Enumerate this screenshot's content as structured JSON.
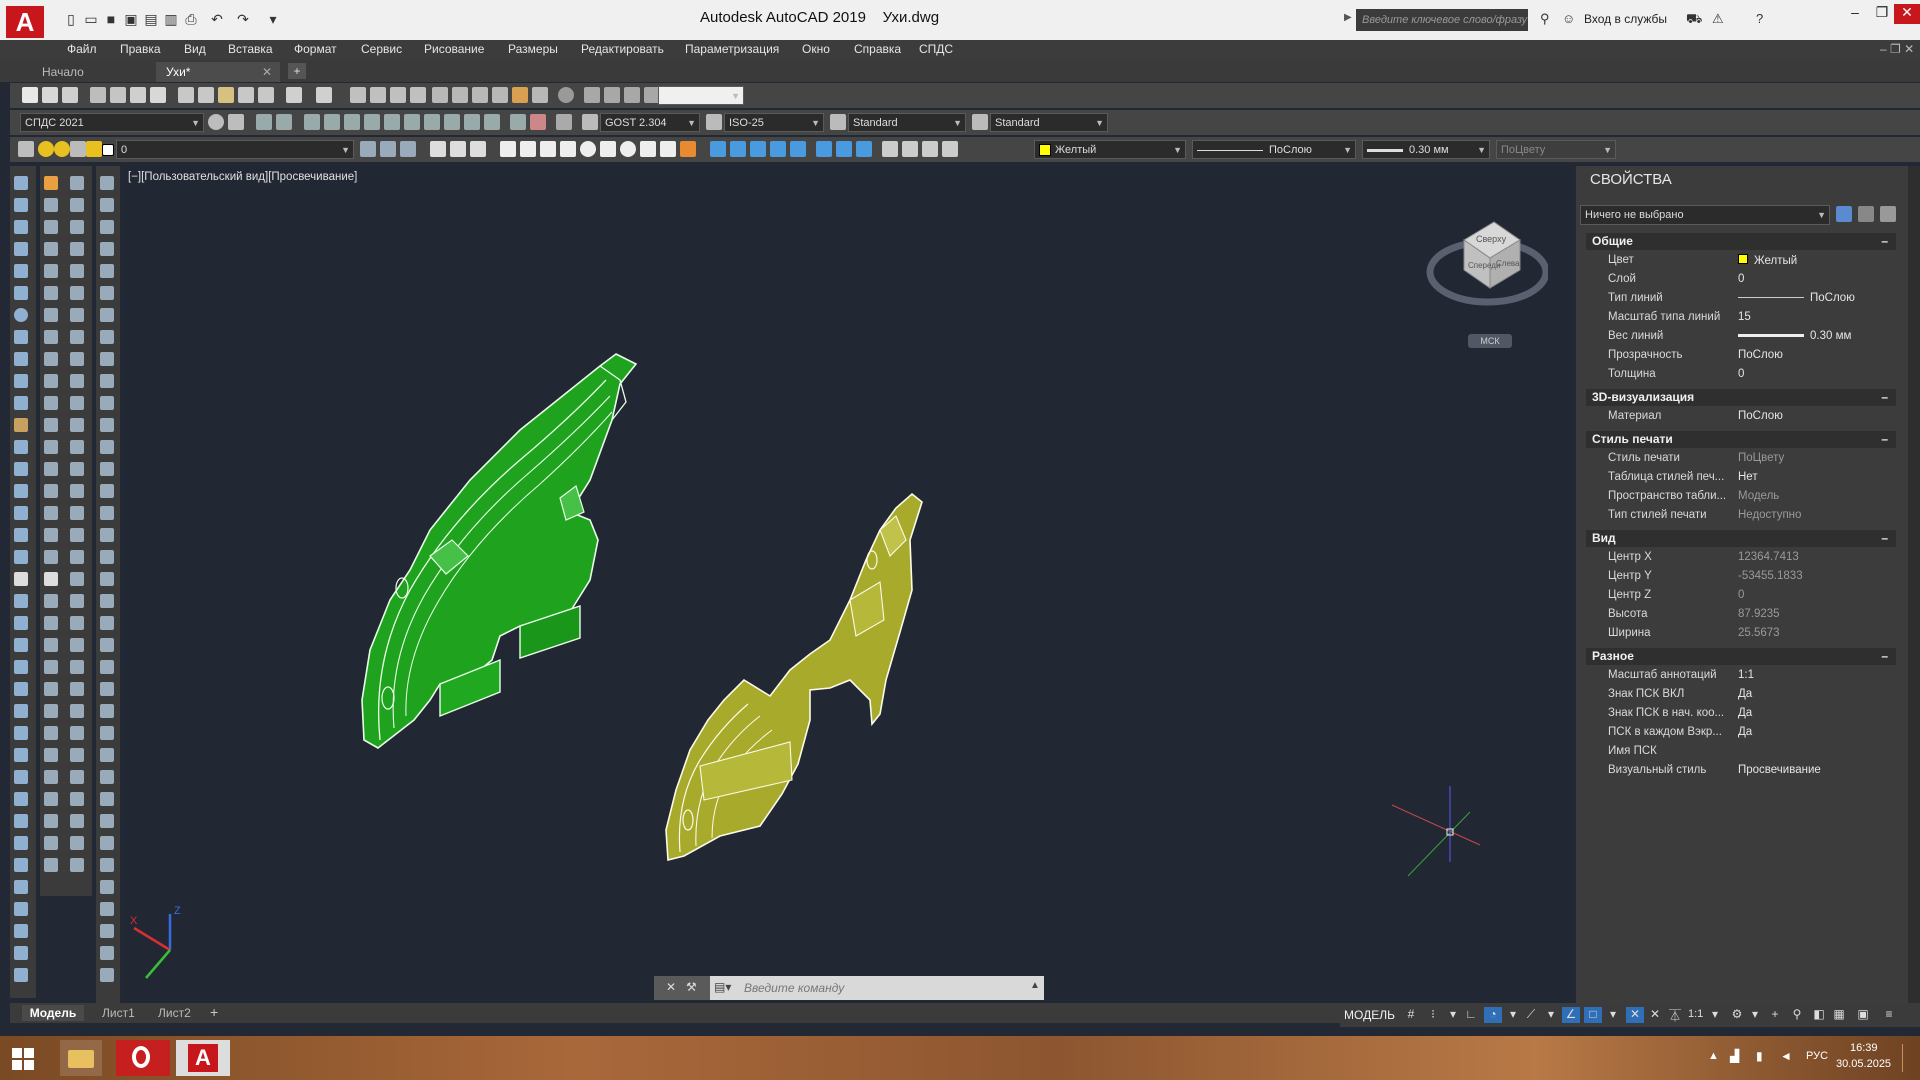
{
  "window": {
    "app_logo": "A",
    "title": "Autodesk AutoCAD 2019",
    "document": "Ухи.dwg",
    "search_placeholder": "Введите ключевое слово/фразу",
    "signin": "Вход в службы"
  },
  "menu": [
    "Файл",
    "Правка",
    "Вид",
    "Вставка",
    "Формат",
    "Сервис",
    "Рисование",
    "Размеры",
    "Редактировать",
    "Параметризация",
    "Окно",
    "Справка",
    "СПДС"
  ],
  "tabs": [
    {
      "label": "Начало"
    },
    {
      "label": "Ухи*"
    }
  ],
  "toolbar2": {
    "workspace": "СПДС 2021",
    "text_style": "GOST 2.304",
    "dim_style": "ISO-25",
    "table_style": "Standard",
    "mleader_style": "Standard"
  },
  "toolbar3": {
    "layer": "0",
    "color": "Желтый",
    "linetype": "ПоСлою",
    "lineweight": "0.30 мм",
    "plotstyle": "ПоЦвету"
  },
  "viewport": {
    "label": "[−][Пользовательский вид][Просвечивание]",
    "viewcube_top": "Сверху",
    "viewcube_front": "Спереди",
    "viewcube_side": "Слева",
    "ucs_label": "МСК"
  },
  "properties": {
    "title": "СВОЙСТВА",
    "selection": "Ничего не выбрано",
    "sections": [
      {
        "title": "Общие",
        "rows": [
          {
            "label": "Цвет",
            "value": "Желтый"
          },
          {
            "label": "Слой",
            "value": "0"
          },
          {
            "label": "Тип линий",
            "value": "ПоСлою"
          },
          {
            "label": "Масштаб типа линий",
            "value": "15"
          },
          {
            "label": "Вес линий",
            "value": "0.30 мм"
          },
          {
            "label": "Прозрачность",
            "value": "ПоСлою"
          },
          {
            "label": "Толщина",
            "value": "0"
          }
        ]
      },
      {
        "title": "3D-визуализация",
        "rows": [
          {
            "label": "Материал",
            "value": "ПоСлою"
          }
        ]
      },
      {
        "title": "Стиль печати",
        "rows": [
          {
            "label": "Стиль печати",
            "value": "ПоЦвету"
          },
          {
            "label": "Таблица стилей печ...",
            "value": "Нет"
          },
          {
            "label": "Пространство табли...",
            "value": "Модель"
          },
          {
            "label": "Тип стилей печати",
            "value": "Недоступно"
          }
        ]
      },
      {
        "title": "Вид",
        "rows": [
          {
            "label": "Центр X",
            "value": "12364.7413"
          },
          {
            "label": "Центр Y",
            "value": "-53455.1833"
          },
          {
            "label": "Центр Z",
            "value": "0"
          },
          {
            "label": "Высота",
            "value": "87.9235"
          },
          {
            "label": "Ширина",
            "value": "25.5673"
          }
        ]
      },
      {
        "title": "Разное",
        "rows": [
          {
            "label": "Масштаб аннотаций",
            "value": "1:1"
          },
          {
            "label": "Знак ПСК ВКЛ",
            "value": "Да"
          },
          {
            "label": "Знак ПСК в нач. коо...",
            "value": "Да"
          },
          {
            "label": "ПСК в каждом Вэкр...",
            "value": "Да"
          },
          {
            "label": "Имя ПСК",
            "value": ""
          },
          {
            "label": "Визуальный стиль",
            "value": "Просвечивание"
          }
        ]
      }
    ]
  },
  "command_line": {
    "placeholder": "Введите команду"
  },
  "layout_tabs": [
    "Модель",
    "Лист1",
    "Лист2"
  ],
  "status": {
    "model": "МОДЕЛЬ",
    "scale": "1:1"
  },
  "taskbar": {
    "lang": "РУС",
    "time": "16:39",
    "date": "30.05.2025"
  },
  "colors": {
    "accent_red": "#c8161d",
    "green_part": "#22b422",
    "yellow_part": "#b8b830"
  }
}
